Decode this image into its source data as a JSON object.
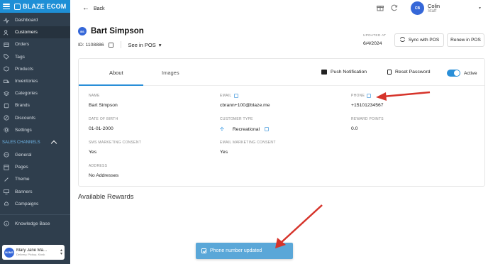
{
  "sidebar": {
    "brand": "BLAZE ECOM",
    "items": [
      {
        "label": "Dashboard",
        "icon": "activity-icon"
      },
      {
        "label": "Customers",
        "icon": "users-icon"
      },
      {
        "label": "Orders",
        "icon": "orders-icon"
      },
      {
        "label": "Tags",
        "icon": "tag-icon"
      },
      {
        "label": "Products",
        "icon": "box-icon"
      },
      {
        "label": "Inventories",
        "icon": "truck-icon"
      },
      {
        "label": "Categories",
        "icon": "layers-icon"
      },
      {
        "label": "Brands",
        "icon": "brand-icon"
      },
      {
        "label": "Discounts",
        "icon": "discount-icon"
      },
      {
        "label": "Settings",
        "icon": "gear-icon"
      }
    ],
    "active_index": 1,
    "section_label": "SALES CHANNELS",
    "channel_items": [
      {
        "label": "General",
        "icon": "globe-icon"
      },
      {
        "label": "Pages",
        "icon": "pages-icon"
      },
      {
        "label": "Theme",
        "icon": "brush-icon"
      },
      {
        "label": "Banners",
        "icon": "banner-icon"
      },
      {
        "label": "Campaigns",
        "icon": "bell-icon"
      }
    ],
    "knowledge_base": "Knowledge Base",
    "store": {
      "avatar": "MJMS",
      "name": "Mary Jane Ma...",
      "sub": "Delivery, Pickup, Kiosk"
    }
  },
  "topbar": {
    "back_label": "Back",
    "user": {
      "initials": "CB",
      "name": "Colin",
      "role": "Staff"
    }
  },
  "customer": {
    "initials": "BS",
    "name": "Bart Simpson",
    "id_text": "ID: 1108886",
    "see_in_pos": "See in POS",
    "updated_label": "UPDATED AT",
    "updated_value": "6/4/2024",
    "sync_button": "Sync with POS",
    "renew_button": "Renew in POS"
  },
  "tabs": {
    "about": "About",
    "images": "Images"
  },
  "actions": {
    "push": "Push Notification",
    "reset": "Reset Password",
    "active": "Active"
  },
  "fields": {
    "name_label": "NAME",
    "name_value": "Bart Simpson",
    "email_label": "EMAIL",
    "email_value": "cbrann+100@blaze.me",
    "phone_label": "PHONE",
    "phone_value": "+15101234567",
    "dob_label": "DATE OF BIRTH",
    "dob_value": "01-01-2000",
    "ctype_label": "CUSTOMER TYPE",
    "ctype_value": "Recreational",
    "reward_label": "REWARD POINTS",
    "reward_value": "0.0",
    "sms_label": "SMS MARKETING CONSENT",
    "sms_value": "Yes",
    "emailmk_label": "EMAIL MARKETING CONSENT",
    "emailmk_value": "Yes",
    "address_label": "ADDRESS",
    "address_value": "No Addresses"
  },
  "rewards_title": "Available Rewards",
  "toast": {
    "message": "Phone number updated"
  },
  "colors": {
    "sidebar": "#2f3e4d",
    "brand": "#1e8fd6",
    "accent": "#2a8fd8",
    "toast": "#5aa7d8",
    "arrow": "#d6332a"
  }
}
